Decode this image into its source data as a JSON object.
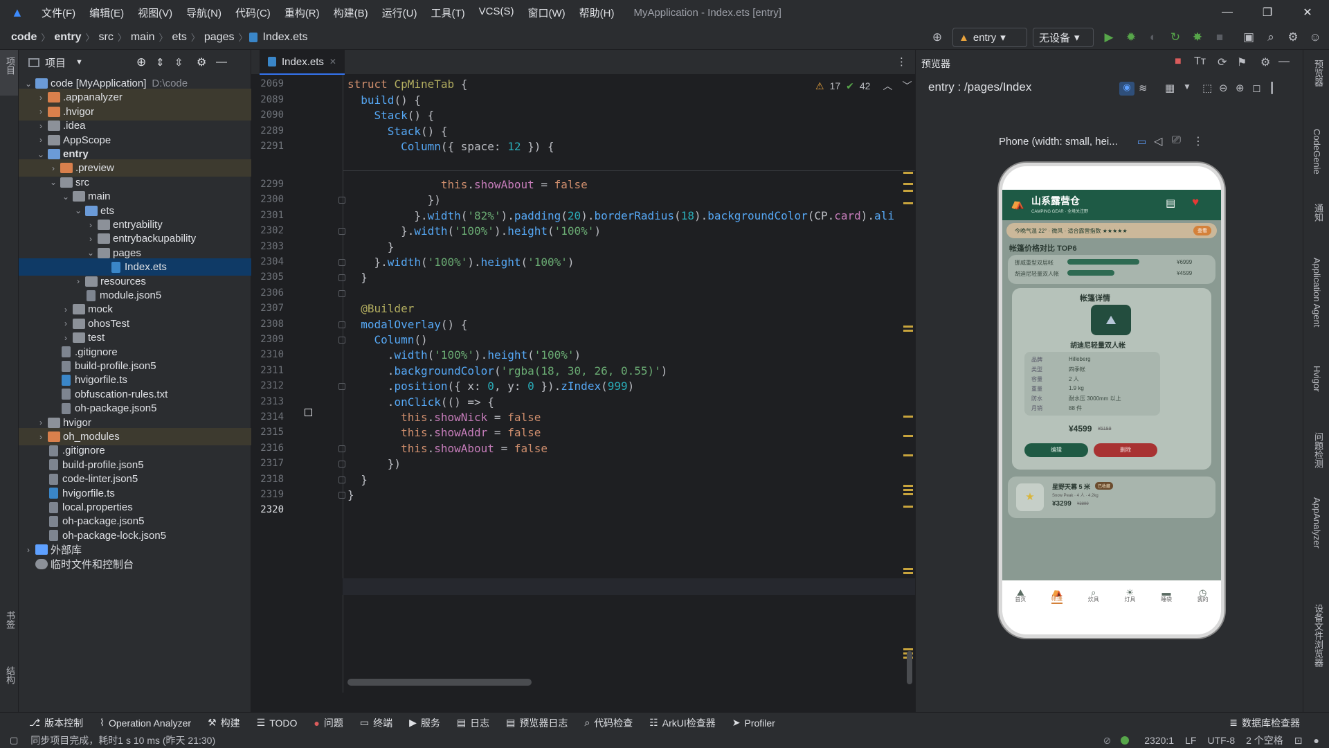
{
  "menubar": {
    "items": [
      "文件(F)",
      "编辑(E)",
      "视图(V)",
      "导航(N)",
      "代码(C)",
      "重构(R)",
      "构建(B)",
      "运行(U)",
      "工具(T)",
      "VCS(S)",
      "窗口(W)",
      "帮助(H)"
    ],
    "title": "MyApplication - Index.ets [entry]"
  },
  "breadcrumb": [
    "code",
    "entry",
    "src",
    "main",
    "ets",
    "pages",
    "Index.ets"
  ],
  "toolbar": {
    "module": "entry",
    "device": "无设备"
  },
  "project": {
    "title": "项目",
    "tree": [
      {
        "label": "code [MyApplication]",
        "extra": "D:\\code",
        "depth": 0,
        "type": "folder-blue",
        "open": true
      },
      {
        "label": ".appanalyzer",
        "depth": 1,
        "type": "folder-orange",
        "hl": true
      },
      {
        "label": ".hvigor",
        "depth": 1,
        "type": "folder-orange",
        "hl": true
      },
      {
        "label": ".idea",
        "depth": 1,
        "type": "folder"
      },
      {
        "label": "AppScope",
        "depth": 1,
        "type": "folder"
      },
      {
        "label": "entry",
        "depth": 1,
        "type": "folder-blue",
        "open": true,
        "bold": true
      },
      {
        "label": ".preview",
        "depth": 2,
        "type": "folder-orange",
        "hl": true
      },
      {
        "label": "src",
        "depth": 2,
        "type": "folder",
        "open": true
      },
      {
        "label": "main",
        "depth": 3,
        "type": "folder",
        "open": true
      },
      {
        "label": "ets",
        "depth": 4,
        "type": "folder-blue",
        "open": true
      },
      {
        "label": "entryability",
        "depth": 5,
        "type": "folder"
      },
      {
        "label": "entrybackupability",
        "depth": 5,
        "type": "folder"
      },
      {
        "label": "pages",
        "depth": 5,
        "type": "folder",
        "open": true
      },
      {
        "label": "Index.ets",
        "depth": 6,
        "type": "file-ts",
        "sel": true
      },
      {
        "label": "resources",
        "depth": 4,
        "type": "folder"
      },
      {
        "label": "module.json5",
        "depth": 4,
        "type": "file"
      },
      {
        "label": "mock",
        "depth": 3,
        "type": "folder"
      },
      {
        "label": "ohosTest",
        "depth": 3,
        "type": "folder"
      },
      {
        "label": "test",
        "depth": 3,
        "type": "folder"
      },
      {
        "label": ".gitignore",
        "depth": 2,
        "type": "file"
      },
      {
        "label": "build-profile.json5",
        "depth": 2,
        "type": "file"
      },
      {
        "label": "hvigorfile.ts",
        "depth": 2,
        "type": "file-ts"
      },
      {
        "label": "obfuscation-rules.txt",
        "depth": 2,
        "type": "file"
      },
      {
        "label": "oh-package.json5",
        "depth": 2,
        "type": "file"
      },
      {
        "label": "hvigor",
        "depth": 1,
        "type": "folder"
      },
      {
        "label": "oh_modules",
        "depth": 1,
        "type": "folder-orange",
        "hl": true
      },
      {
        "label": ".gitignore",
        "depth": 1,
        "type": "file"
      },
      {
        "label": "build-profile.json5",
        "depth": 1,
        "type": "file"
      },
      {
        "label": "code-linter.json5",
        "depth": 1,
        "type": "file"
      },
      {
        "label": "hvigorfile.ts",
        "depth": 1,
        "type": "file-ts"
      },
      {
        "label": "local.properties",
        "depth": 1,
        "type": "file"
      },
      {
        "label": "oh-package.json5",
        "depth": 1,
        "type": "file"
      },
      {
        "label": "oh-package-lock.json5",
        "depth": 1,
        "type": "file"
      },
      {
        "label": "外部库",
        "depth": 0,
        "type": "lib"
      },
      {
        "label": "临时文件和控制台",
        "depth": 0,
        "type": "scratch"
      }
    ]
  },
  "editor": {
    "tab": "Index.ets",
    "warnings": "17",
    "checks": "42",
    "lines": [
      {
        "n": "2069",
        "html": "<span class='kw'>struct</span> <span class='ann'>CpMineTab</span> {"
      },
      {
        "n": "2089",
        "html": "  <span class='fn'>build</span>() {"
      },
      {
        "n": "2090",
        "html": "    <span class='fn'>Stack</span>() {"
      },
      {
        "n": "2289",
        "html": "      <span class='fn'>Stack</span>() {"
      },
      {
        "n": "2291",
        "html": "        <span class='fn'>Column</span>({ space: <span class='num'>12</span> }) {"
      },
      {
        "n": "2299",
        "html": "              <span class='kw'>this</span>.<span class='prop'>showAbout</span> = <span class='kw'>false</span>"
      },
      {
        "n": "2300",
        "html": "            })"
      },
      {
        "n": "2301",
        "html": "          }.<span class='fn'>width</span>(<span class='str'>'82%'</span>).<span class='fn'>padding</span>(<span class='num'>20</span>).<span class='fn'>borderRadius</span>(<span class='num'>18</span>).<span class='fn'>backgroundColor</span>(CP.<span class='prop'>card</span>).<span class='fn'>ali</span>"
      },
      {
        "n": "2302",
        "html": "        }.<span class='fn'>width</span>(<span class='str'>'100%'</span>).<span class='fn'>height</span>(<span class='str'>'100%'</span>)"
      },
      {
        "n": "2303",
        "html": "      }"
      },
      {
        "n": "2304",
        "html": "    }.<span class='fn'>width</span>(<span class='str'>'100%'</span>).<span class='fn'>height</span>(<span class='str'>'100%'</span>)"
      },
      {
        "n": "2305",
        "html": "  }"
      },
      {
        "n": "2306",
        "html": ""
      },
      {
        "n": "2307",
        "html": "  <span class='ann'>@Builder</span>"
      },
      {
        "n": "2308",
        "html": "  <span class='fn'>modalOverlay</span>() {"
      },
      {
        "n": "2309",
        "html": "    <span class='fn'>Column</span>()"
      },
      {
        "n": "2310",
        "html": "      .<span class='fn'>width</span>(<span class='str'>'100%'</span>).<span class='fn'>height</span>(<span class='str'>'100%'</span>)"
      },
      {
        "n": "2311",
        "html": "      .<span class='fn'>backgroundColor</span>(<span class='str'>'rgba(18, 30, 26, 0.55)'</span>)"
      },
      {
        "n": "2312",
        "html": "      .<span class='fn'>position</span>({ x: <span class='num'>0</span>, y: <span class='num'>0</span> }).<span class='fn'>zIndex</span>(<span class='num'>999</span>)"
      },
      {
        "n": "2313",
        "html": "      .<span class='fn'>onClick</span>(() => {"
      },
      {
        "n": "2314",
        "html": "        <span class='kw'>this</span>.<span class='prop'>showNick</span> = <span class='kw'>false</span>"
      },
      {
        "n": "2315",
        "html": "        <span class='kw'>this</span>.<span class='prop'>showAddr</span> = <span class='kw'>false</span>"
      },
      {
        "n": "2316",
        "html": "        <span class='kw'>this</span>.<span class='prop'>showAbout</span> = <span class='kw'>false</span>"
      },
      {
        "n": "2317",
        "html": "      })"
      },
      {
        "n": "2318",
        "html": "  }"
      },
      {
        "n": "2319",
        "html": "}"
      },
      {
        "n": "2320",
        "html": ""
      }
    ]
  },
  "preview": {
    "title": "预览器",
    "route": "entry : /pages/Index",
    "device": "Phone (width: small, hei...",
    "app": {
      "name": "山系露营仓",
      "subtitle": "CAMPING GEAR · 全境关注野",
      "banner": "今晚气温 22° · 微风 · 适合露营指数 ★★★★★",
      "banner_badge": "查看",
      "section": "帐篷价格对比 TOP6",
      "compare": [
        {
          "name": "挪威重型双层帐",
          "price": "¥6999"
        },
        {
          "name": "胡迪尼轻量双人帐",
          "price": "¥4599"
        }
      ],
      "detail_title": "帐篷详情",
      "product_name": "胡迪尼轻量双人帐",
      "specs": [
        {
          "k": "品牌",
          "v": "Hilleberg"
        },
        {
          "k": "类型",
          "v": "四季帐"
        },
        {
          "k": "容量",
          "v": "2 人"
        },
        {
          "k": "重量",
          "v": "1.9 kg"
        },
        {
          "k": "防水",
          "v": "耐水压 3000mm 以上"
        },
        {
          "k": "月销",
          "v": "88 件"
        }
      ],
      "price": "¥4599",
      "old_price": "¥5199",
      "btn_left": "编辑",
      "btn_right": "删除",
      "card2_name": "星野天幕 5 米",
      "card2_badge": "已收藏",
      "card2_sub": "Snow Peak · 4 人 · 4.2kg",
      "card2_price": "¥3299",
      "card2_old": "¥3899",
      "nav": [
        "首页",
        "帐篷",
        "炊具",
        "灯具",
        "睡袋",
        "我的"
      ]
    }
  },
  "bottom_tools": [
    "版本控制",
    "Operation Analyzer",
    "构建",
    "TODO",
    "问题",
    "终端",
    "服务",
    "日志",
    "预览器日志",
    "代码检查",
    "ArkUI检查器",
    "Profiler"
  ],
  "bottom_right": "数据库检查器",
  "status": {
    "message": "同步项目完成，耗时1 s 10 ms (昨天 21:30)",
    "pos": "2320:1",
    "lf": "LF",
    "enc": "UTF-8",
    "indent": "2 个空格"
  },
  "left_strip": [
    "项目",
    "书签",
    "结构"
  ],
  "right_strip": [
    "预览器",
    "CodeGenie",
    "通知",
    "Application Agent",
    "Hvigor",
    "问题检测",
    "AppAnalyzer",
    "设备文件浏览器"
  ]
}
